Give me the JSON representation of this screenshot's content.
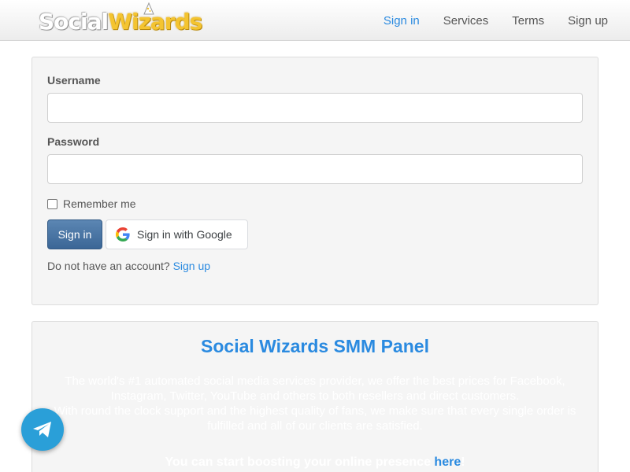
{
  "brand": {
    "logo_part1": "Social",
    "logo_part2": "Wiz",
    "logo_part3": "rds"
  },
  "nav": {
    "sign_in": "Sign in",
    "services": "Services",
    "terms": "Terms",
    "sign_up": "Sign up"
  },
  "login": {
    "username_label": "Username",
    "username_value": "",
    "password_label": "Password",
    "password_value": "",
    "remember_label": "Remember me",
    "remember_checked": false,
    "signin_button": "Sign in",
    "google_button": "Sign in with Google",
    "no_account_text": "Do not have an account?",
    "signup_link": "Sign up"
  },
  "promo": {
    "title": "Social Wizards SMM Panel",
    "text_line1": "The world's #1 automated social media services provider, we offer the best prices for Facebook, Instagram, Twitter, YouTube and others to both resellers and direct customers.",
    "text_line2": "With round the clock support and the highest quality of fans, we make sure that every single order is fulfilled and all of our clients are satisfied.",
    "cta_text": "You can start boosting your online presence ",
    "cta_link": "here",
    "cta_end": "!"
  },
  "colors": {
    "accent": "#2a8ae0",
    "button": "#3b6696",
    "panel": "#f5f5f5",
    "telegram": "#2a9fd8"
  },
  "icons": {
    "google": "google-g-icon",
    "telegram": "telegram-icon"
  }
}
